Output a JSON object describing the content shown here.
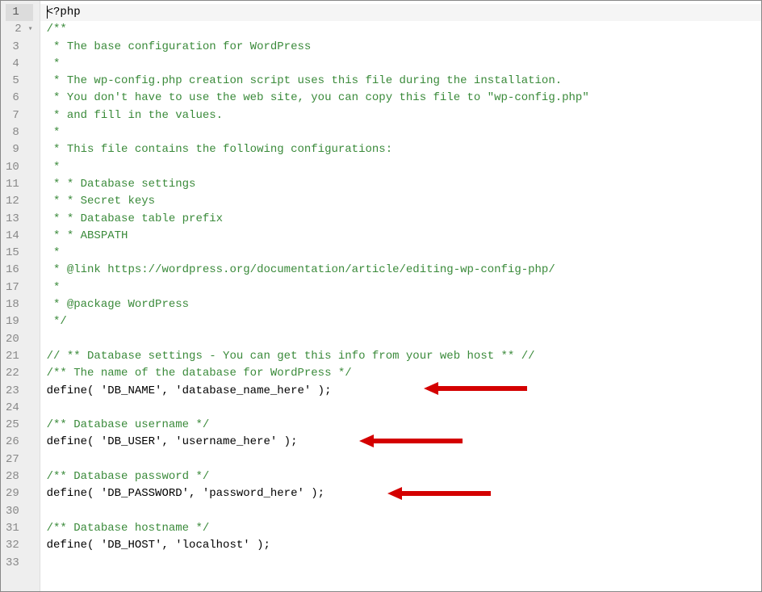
{
  "gutter": {
    "lines": [
      "1",
      "2",
      "3",
      "4",
      "5",
      "6",
      "7",
      "8",
      "9",
      "10",
      "11",
      "12",
      "13",
      "14",
      "15",
      "16",
      "17",
      "18",
      "19",
      "20",
      "21",
      "22",
      "23",
      "24",
      "25",
      "26",
      "27",
      "28",
      "29",
      "30",
      "31",
      "32",
      "33"
    ],
    "foldLine": 2,
    "activeLine": 1
  },
  "code": {
    "l1": "<?php",
    "l2": "/**",
    "l3": " * The base configuration for WordPress",
    "l4": " *",
    "l5": " * The wp-config.php creation script uses this file during the installation.",
    "l6": " * You don't have to use the web site, you can copy this file to \"wp-config.php\"",
    "l7": " * and fill in the values.",
    "l8": " *",
    "l9": " * This file contains the following configurations:",
    "l10": " *",
    "l11": " * * Database settings",
    "l12": " * * Secret keys",
    "l13": " * * Database table prefix",
    "l14": " * * ABSPATH",
    "l15": " *",
    "l16": " * @link https://wordpress.org/documentation/article/editing-wp-config-php/",
    "l17": " *",
    "l18": " * @package WordPress",
    "l19": " */",
    "l20": "",
    "l21": "// ** Database settings - You can get this info from your web host ** //",
    "l22": "/** The name of the database for WordPress */",
    "l23": "define( 'DB_NAME', 'database_name_here' );",
    "l24": "",
    "l25": "/** Database username */",
    "l26": "define( 'DB_USER', 'username_here' );",
    "l27": "",
    "l28": "/** Database password */",
    "l29": "define( 'DB_PASSWORD', 'password_here' );",
    "l30": "",
    "l31": "/** Database hostname */",
    "l32": "define( 'DB_HOST', 'localhost' );",
    "l33": ""
  },
  "arrows": {
    "color": "#d40000"
  }
}
